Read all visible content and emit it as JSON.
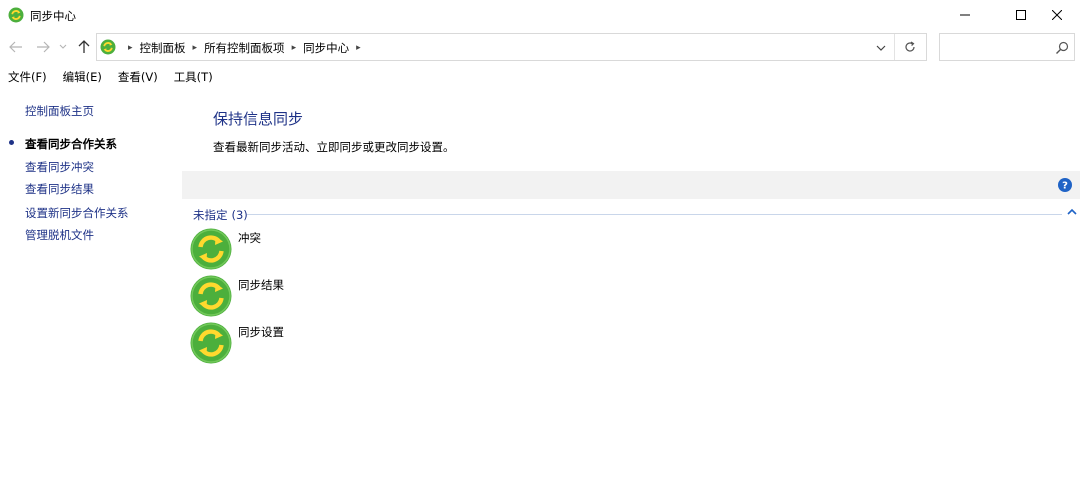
{
  "window": {
    "title": "同步中心",
    "icon": "sync-center-icon",
    "buttons": {
      "minimize": "minimize-icon",
      "maximize": "maximize-icon",
      "close": "close-icon"
    }
  },
  "nav": {
    "back_icon": "arrow-left-icon",
    "forward_icon": "arrow-right-icon",
    "recent_icon": "chevron-down-icon",
    "up_icon": "arrow-up-icon",
    "breadcrumbs": [
      "控制面板",
      "所有控制面板项",
      "同步中心"
    ],
    "search_placeholder": ""
  },
  "menu": {
    "items": [
      "文件(F)",
      "编辑(E)",
      "查看(V)",
      "工具(T)"
    ]
  },
  "sidebar": {
    "home": "控制面板主页",
    "links": [
      "查看同步合作关系",
      "查看同步冲突",
      "查看同步结果",
      "设置新同步合作关系",
      "管理脱机文件"
    ],
    "active_index": 0
  },
  "content": {
    "heading": "保持信息同步",
    "description": "查看最新同步活动、立即同步或更改同步设置。",
    "group": {
      "label": "未指定",
      "count": "(3)"
    },
    "items": [
      {
        "label": "冲突",
        "icon": "sync-icon"
      },
      {
        "label": "同步结果",
        "icon": "sync-icon"
      },
      {
        "label": "同步设置",
        "icon": "sync-icon"
      }
    ]
  },
  "colors": {
    "link": "#1e3287",
    "band": "#f2f2f2",
    "sync_green": "#4caf3c",
    "sync_yellow": "#ffd92e"
  }
}
